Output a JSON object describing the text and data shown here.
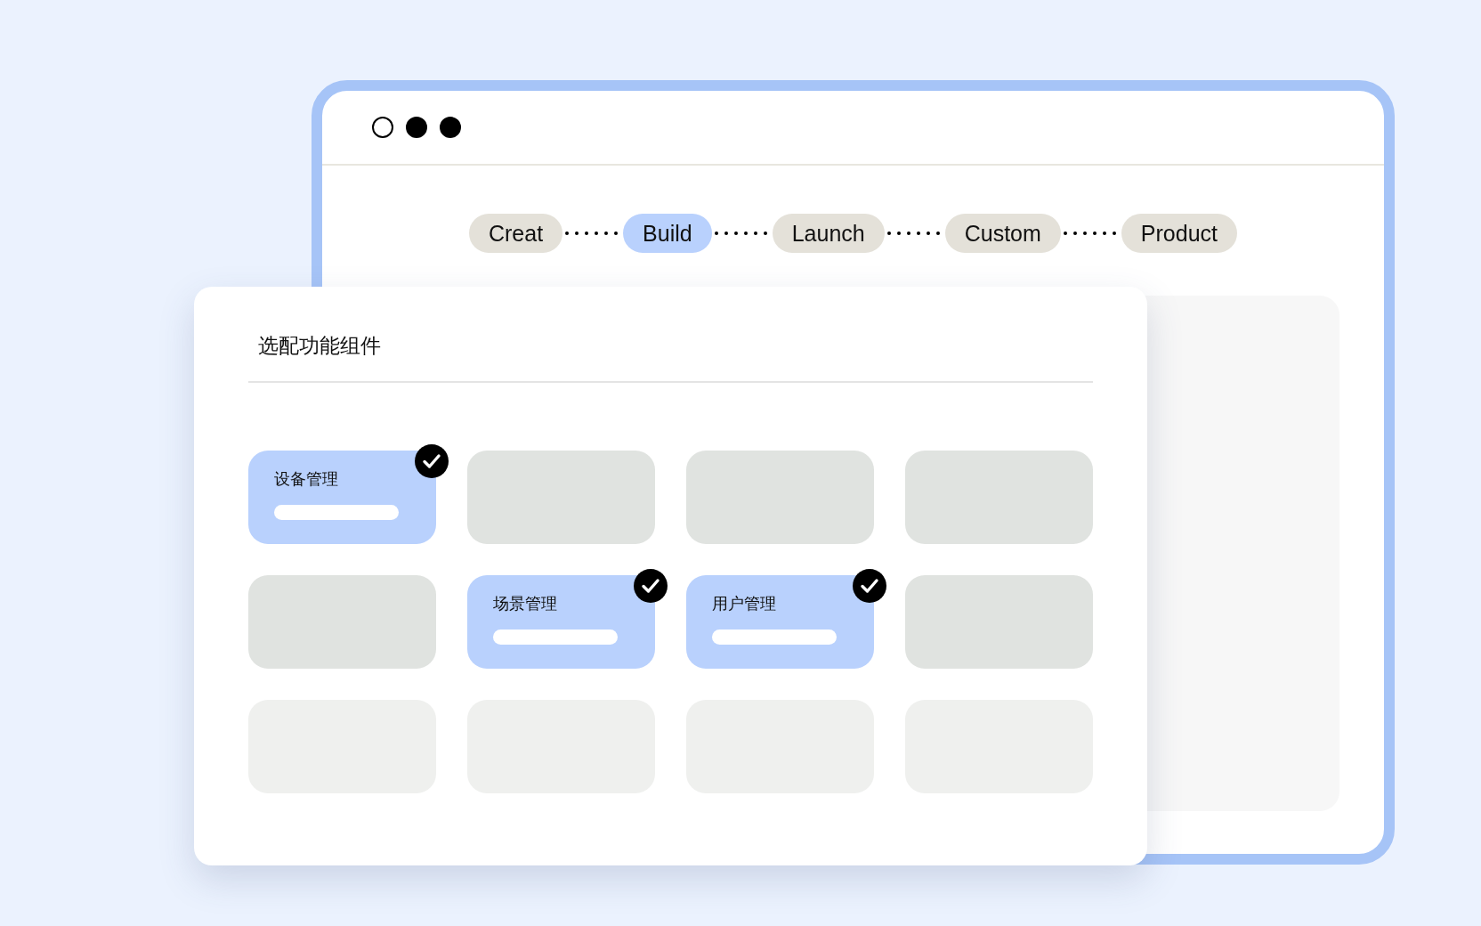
{
  "window": {
    "dots": [
      {
        "filled": false
      },
      {
        "filled": true
      },
      {
        "filled": true
      }
    ],
    "steps": [
      {
        "label": "Creat",
        "selected": false
      },
      {
        "label": "Build",
        "selected": true
      },
      {
        "label": "Launch",
        "selected": false
      },
      {
        "label": "Custom",
        "selected": false
      },
      {
        "label": "Product",
        "selected": false
      }
    ]
  },
  "panel": {
    "title": "选配功能组件",
    "tiles": [
      {
        "kind": "option",
        "label": "设备管理",
        "checked": true
      },
      {
        "kind": "empty"
      },
      {
        "kind": "empty"
      },
      {
        "kind": "empty"
      },
      {
        "kind": "empty"
      },
      {
        "kind": "option",
        "label": "场景管理",
        "checked": true
      },
      {
        "kind": "option",
        "label": "用户管理",
        "checked": true
      },
      {
        "kind": "empty"
      },
      {
        "kind": "faint"
      },
      {
        "kind": "faint"
      },
      {
        "kind": "faint"
      },
      {
        "kind": "faint"
      }
    ]
  }
}
